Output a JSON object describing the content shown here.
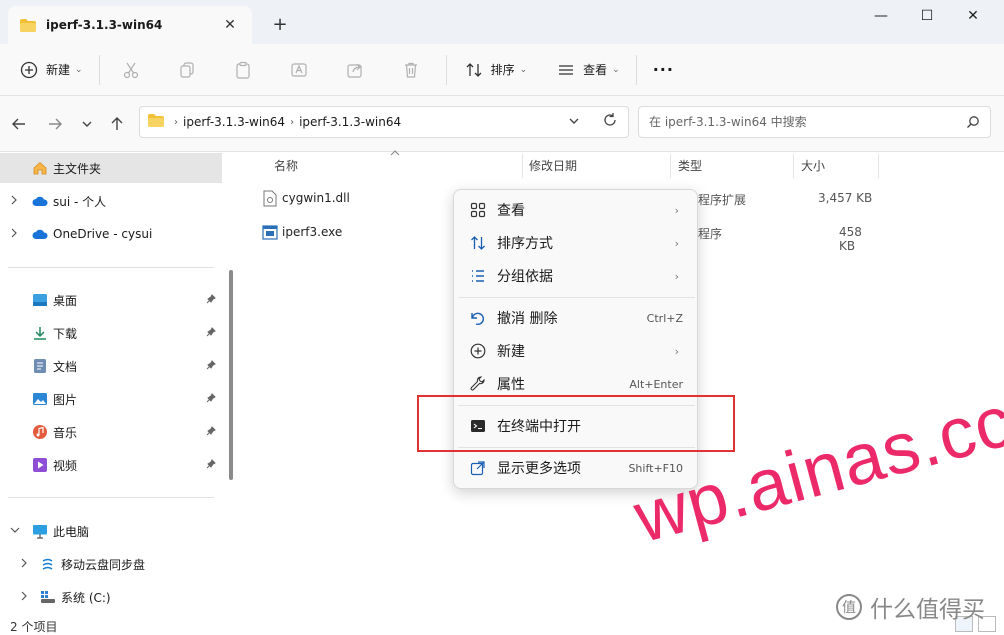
{
  "window": {
    "tab_title": "iperf-3.1.3-win64",
    "tab_close": "✕",
    "new_tab": "+",
    "min": "—",
    "max": "☐",
    "close": "✕"
  },
  "toolbar": {
    "new_label": "新建",
    "sort_label": "排序",
    "view_label": "查看",
    "more": "···",
    "caret": "⌄"
  },
  "address": {
    "crumbs": [
      "iperf-3.1.3-win64",
      "iperf-3.1.3-win64"
    ],
    "sep": "›",
    "search_placeholder": "在 iperf-3.1.3-win64 中搜索"
  },
  "sidebar": {
    "home": "主文件夹",
    "sui": "sui - 个人",
    "onedrive": "OneDrive - cysui",
    "quick": [
      "桌面",
      "下载",
      "文档",
      "图片",
      "音乐",
      "视频"
    ],
    "this_pc": "此电脑",
    "cloud": "移动云盘同步盘",
    "system": "系统 (C:)"
  },
  "columns": {
    "name": "名称",
    "date": "修改日期",
    "type": "类型",
    "size": "大小"
  },
  "files": [
    {
      "name": "cygwin1.dll",
      "type": "程序扩展",
      "size": "3,457 KB"
    },
    {
      "name": "iperf3.exe",
      "type": "程序",
      "size": "458 KB"
    }
  ],
  "context_menu": {
    "view": "查看",
    "sort": "排序方式",
    "group": "分组依据",
    "undo": "撤消 删除",
    "undo_shortcut": "Ctrl+Z",
    "new": "新建",
    "properties": "属性",
    "properties_shortcut": "Alt+Enter",
    "open_terminal": "在终端中打开",
    "show_more": "显示更多选项",
    "show_more_shortcut": "Shift+F10",
    "arrow": "›"
  },
  "status": {
    "count": "2 个项目"
  },
  "watermark": {
    "text": "wp.ainas.cc",
    "logo_text": "什么值得买",
    "logo_glyph": "值"
  },
  "colors": {
    "accent": "#0067c0",
    "folder": "#f2c037",
    "highlight": "#e03232",
    "watermark": "#ec2a6a"
  }
}
